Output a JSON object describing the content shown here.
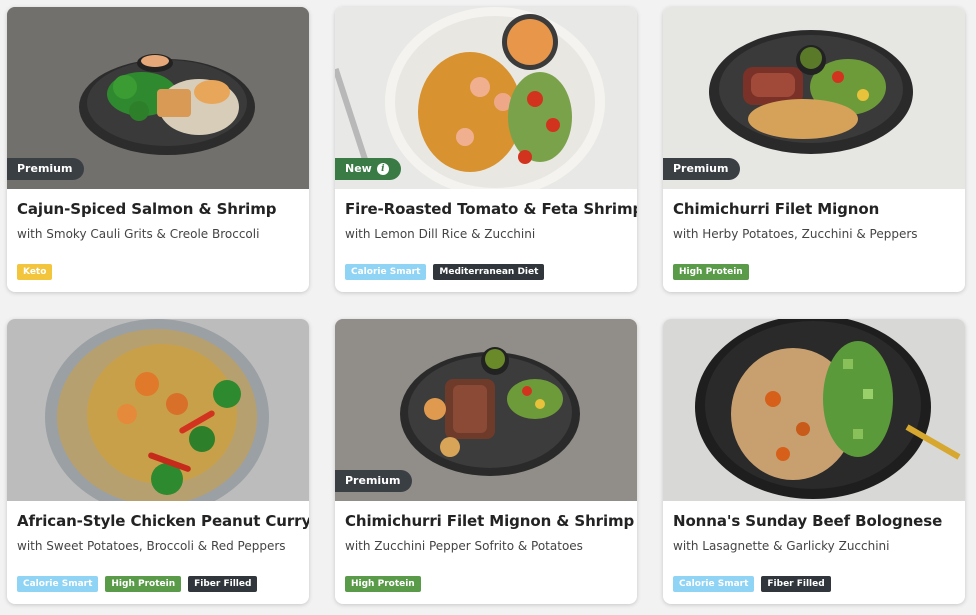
{
  "cards": [
    {
      "badge": "Premium",
      "title": "Cajun-Spiced Salmon & Shrimp",
      "subtitle": "with Smoky Cauli Grits & Creole Broccoli",
      "tags": [
        "Keto"
      ]
    },
    {
      "badge": "New",
      "badge_icon": "info-icon",
      "title": "Fire-Roasted Tomato & Feta Shrimp",
      "subtitle": "with Lemon Dill Rice & Zucchini",
      "tags": [
        "Calorie Smart",
        "Mediterranean Diet"
      ]
    },
    {
      "badge": "Premium",
      "title": "Chimichurri Filet Mignon",
      "subtitle": "with Herby Potatoes, Zucchini & Peppers",
      "tags": [
        "High Protein"
      ]
    },
    {
      "title": "African-Style Chicken Peanut Curry",
      "subtitle": "with Sweet Potatoes, Broccoli & Red Peppers",
      "tags": [
        "Calorie Smart",
        "High Protein",
        "Fiber Filled"
      ]
    },
    {
      "badge": "Premium",
      "title": "Chimichurri Filet Mignon & Shrimp",
      "subtitle": "with Zucchini Pepper Sofrito & Potatoes",
      "tags": [
        "High Protein"
      ]
    },
    {
      "title": "Nonna's Sunday Beef Bolognese",
      "subtitle": "with Lasagnette & Garlicky Zucchini",
      "tags": [
        "Calorie Smart",
        "Fiber Filled"
      ]
    }
  ],
  "colors": {
    "premium_badge": "#3a3f44",
    "new_badge": "#3a7a45",
    "keto_tag": "#f2c53d",
    "calorie_smart_tag": "#8fd3f5",
    "high_protein_tag": "#5a9b4a",
    "dark_tag": "#30363b"
  }
}
